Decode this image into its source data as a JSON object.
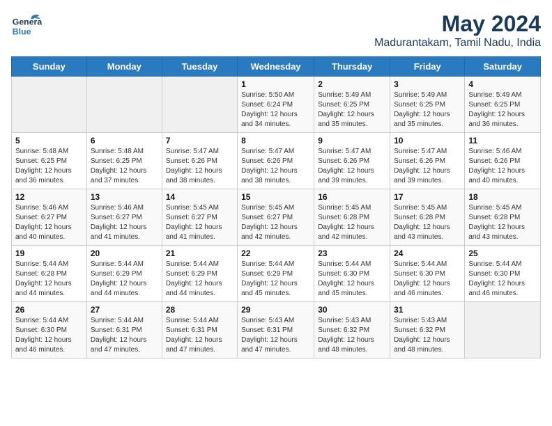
{
  "header": {
    "logo": {
      "general": "General",
      "blue": "Blue"
    },
    "title": "May 2024",
    "subtitle": "Madurantakam, Tamil Nadu, India"
  },
  "calendar": {
    "weekdays": [
      "Sunday",
      "Monday",
      "Tuesday",
      "Wednesday",
      "Thursday",
      "Friday",
      "Saturday"
    ],
    "weeks": [
      [
        {
          "day": "",
          "sunrise": "",
          "sunset": "",
          "daylight": ""
        },
        {
          "day": "",
          "sunrise": "",
          "sunset": "",
          "daylight": ""
        },
        {
          "day": "",
          "sunrise": "",
          "sunset": "",
          "daylight": ""
        },
        {
          "day": "1",
          "sunrise": "Sunrise: 5:50 AM",
          "sunset": "Sunset: 6:24 PM",
          "daylight": "Daylight: 12 hours and 34 minutes."
        },
        {
          "day": "2",
          "sunrise": "Sunrise: 5:49 AM",
          "sunset": "Sunset: 6:25 PM",
          "daylight": "Daylight: 12 hours and 35 minutes."
        },
        {
          "day": "3",
          "sunrise": "Sunrise: 5:49 AM",
          "sunset": "Sunset: 6:25 PM",
          "daylight": "Daylight: 12 hours and 35 minutes."
        },
        {
          "day": "4",
          "sunrise": "Sunrise: 5:49 AM",
          "sunset": "Sunset: 6:25 PM",
          "daylight": "Daylight: 12 hours and 36 minutes."
        }
      ],
      [
        {
          "day": "5",
          "sunrise": "Sunrise: 5:48 AM",
          "sunset": "Sunset: 6:25 PM",
          "daylight": "Daylight: 12 hours and 36 minutes."
        },
        {
          "day": "6",
          "sunrise": "Sunrise: 5:48 AM",
          "sunset": "Sunset: 6:25 PM",
          "daylight": "Daylight: 12 hours and 37 minutes."
        },
        {
          "day": "7",
          "sunrise": "Sunrise: 5:47 AM",
          "sunset": "Sunset: 6:26 PM",
          "daylight": "Daylight: 12 hours and 38 minutes."
        },
        {
          "day": "8",
          "sunrise": "Sunrise: 5:47 AM",
          "sunset": "Sunset: 6:26 PM",
          "daylight": "Daylight: 12 hours and 38 minutes."
        },
        {
          "day": "9",
          "sunrise": "Sunrise: 5:47 AM",
          "sunset": "Sunset: 6:26 PM",
          "daylight": "Daylight: 12 hours and 39 minutes."
        },
        {
          "day": "10",
          "sunrise": "Sunrise: 5:47 AM",
          "sunset": "Sunset: 6:26 PM",
          "daylight": "Daylight: 12 hours and 39 minutes."
        },
        {
          "day": "11",
          "sunrise": "Sunrise: 5:46 AM",
          "sunset": "Sunset: 6:26 PM",
          "daylight": "Daylight: 12 hours and 40 minutes."
        }
      ],
      [
        {
          "day": "12",
          "sunrise": "Sunrise: 5:46 AM",
          "sunset": "Sunset: 6:27 PM",
          "daylight": "Daylight: 12 hours and 40 minutes."
        },
        {
          "day": "13",
          "sunrise": "Sunrise: 5:46 AM",
          "sunset": "Sunset: 6:27 PM",
          "daylight": "Daylight: 12 hours and 41 minutes."
        },
        {
          "day": "14",
          "sunrise": "Sunrise: 5:45 AM",
          "sunset": "Sunset: 6:27 PM",
          "daylight": "Daylight: 12 hours and 41 minutes."
        },
        {
          "day": "15",
          "sunrise": "Sunrise: 5:45 AM",
          "sunset": "Sunset: 6:27 PM",
          "daylight": "Daylight: 12 hours and 42 minutes."
        },
        {
          "day": "16",
          "sunrise": "Sunrise: 5:45 AM",
          "sunset": "Sunset: 6:28 PM",
          "daylight": "Daylight: 12 hours and 42 minutes."
        },
        {
          "day": "17",
          "sunrise": "Sunrise: 5:45 AM",
          "sunset": "Sunset: 6:28 PM",
          "daylight": "Daylight: 12 hours and 43 minutes."
        },
        {
          "day": "18",
          "sunrise": "Sunrise: 5:45 AM",
          "sunset": "Sunset: 6:28 PM",
          "daylight": "Daylight: 12 hours and 43 minutes."
        }
      ],
      [
        {
          "day": "19",
          "sunrise": "Sunrise: 5:44 AM",
          "sunset": "Sunset: 6:28 PM",
          "daylight": "Daylight: 12 hours and 44 minutes."
        },
        {
          "day": "20",
          "sunrise": "Sunrise: 5:44 AM",
          "sunset": "Sunset: 6:29 PM",
          "daylight": "Daylight: 12 hours and 44 minutes."
        },
        {
          "day": "21",
          "sunrise": "Sunrise: 5:44 AM",
          "sunset": "Sunset: 6:29 PM",
          "daylight": "Daylight: 12 hours and 44 minutes."
        },
        {
          "day": "22",
          "sunrise": "Sunrise: 5:44 AM",
          "sunset": "Sunset: 6:29 PM",
          "daylight": "Daylight: 12 hours and 45 minutes."
        },
        {
          "day": "23",
          "sunrise": "Sunrise: 5:44 AM",
          "sunset": "Sunset: 6:30 PM",
          "daylight": "Daylight: 12 hours and 45 minutes."
        },
        {
          "day": "24",
          "sunrise": "Sunrise: 5:44 AM",
          "sunset": "Sunset: 6:30 PM",
          "daylight": "Daylight: 12 hours and 46 minutes."
        },
        {
          "day": "25",
          "sunrise": "Sunrise: 5:44 AM",
          "sunset": "Sunset: 6:30 PM",
          "daylight": "Daylight: 12 hours and 46 minutes."
        }
      ],
      [
        {
          "day": "26",
          "sunrise": "Sunrise: 5:44 AM",
          "sunset": "Sunset: 6:30 PM",
          "daylight": "Daylight: 12 hours and 46 minutes."
        },
        {
          "day": "27",
          "sunrise": "Sunrise: 5:44 AM",
          "sunset": "Sunset: 6:31 PM",
          "daylight": "Daylight: 12 hours and 47 minutes."
        },
        {
          "day": "28",
          "sunrise": "Sunrise: 5:44 AM",
          "sunset": "Sunset: 6:31 PM",
          "daylight": "Daylight: 12 hours and 47 minutes."
        },
        {
          "day": "29",
          "sunrise": "Sunrise: 5:43 AM",
          "sunset": "Sunset: 6:31 PM",
          "daylight": "Daylight: 12 hours and 47 minutes."
        },
        {
          "day": "30",
          "sunrise": "Sunrise: 5:43 AM",
          "sunset": "Sunset: 6:32 PM",
          "daylight": "Daylight: 12 hours and 48 minutes."
        },
        {
          "day": "31",
          "sunrise": "Sunrise: 5:43 AM",
          "sunset": "Sunset: 6:32 PM",
          "daylight": "Daylight: 12 hours and 48 minutes."
        },
        {
          "day": "",
          "sunrise": "",
          "sunset": "",
          "daylight": ""
        }
      ]
    ]
  }
}
